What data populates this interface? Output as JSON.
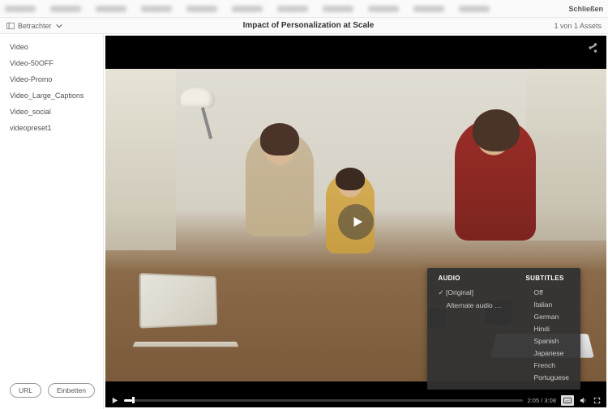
{
  "topnav": {
    "close": "Schließen"
  },
  "toolbar": {
    "viewer_label": "Betrachter",
    "title": "Impact of Personalization at Scale",
    "assets_count": "1 von 1 Assets"
  },
  "sidebar": {
    "items": [
      {
        "label": "Video"
      },
      {
        "label": "Video-50OFF"
      },
      {
        "label": "Video-Promo"
      },
      {
        "label": "Video_Large_Captions"
      },
      {
        "label": "Video_social"
      },
      {
        "label": "videopreset1"
      }
    ],
    "url_btn": "URL",
    "embed_btn": "Einbetten"
  },
  "player": {
    "timecode": "2:05 / 3:08",
    "captions_menu": {
      "audio_header": "AUDIO",
      "subtitles_header": "SUBTITLES",
      "audio_options": [
        {
          "label": "[Original]",
          "selected": true
        },
        {
          "label": "Alternate audio t…",
          "selected": false
        }
      ],
      "subtitle_options": [
        {
          "label": "Off"
        },
        {
          "label": "Italian"
        },
        {
          "label": "German"
        },
        {
          "label": "Hindi"
        },
        {
          "label": "Spanish"
        },
        {
          "label": "Japanese"
        },
        {
          "label": "French"
        },
        {
          "label": "Portuguese"
        }
      ]
    }
  }
}
